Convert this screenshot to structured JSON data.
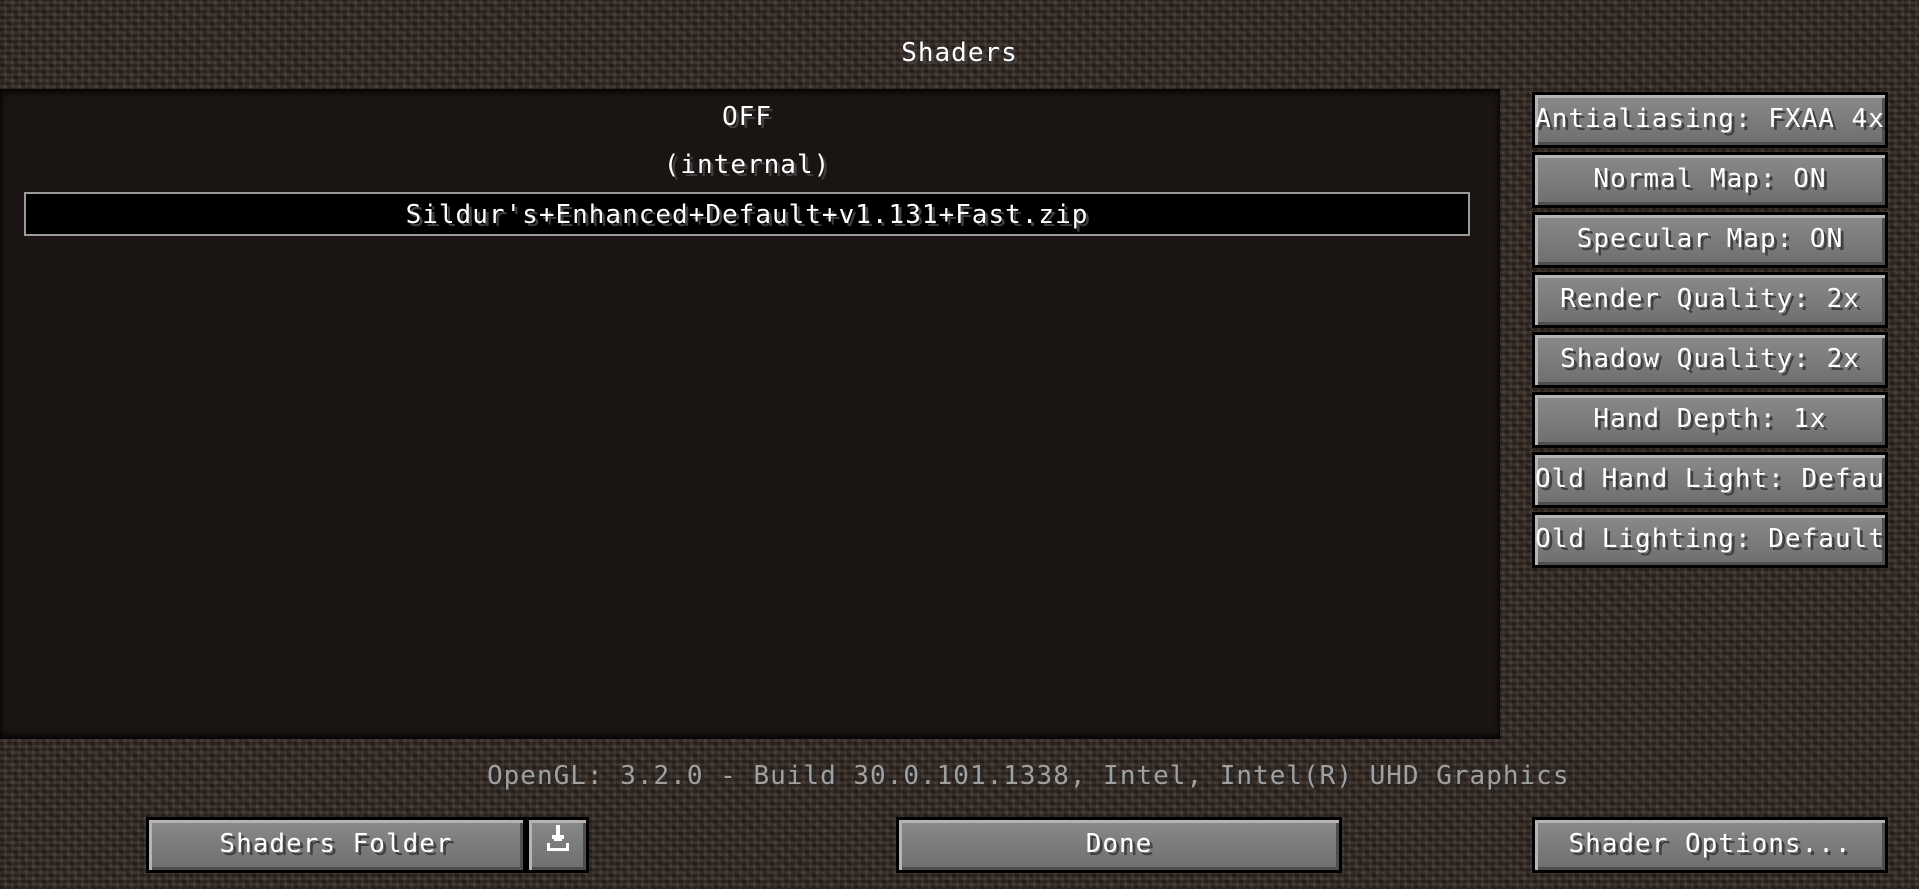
{
  "screen": {
    "title": "Shaders"
  },
  "shader_list": {
    "items": [
      {
        "label": "OFF",
        "selected": false
      },
      {
        "label": "(internal)",
        "selected": false
      },
      {
        "label": "Sildur's+Enhanced+Default+v1.131+Fast.zip",
        "selected": true
      }
    ]
  },
  "options": [
    {
      "label": "Antialiasing: FXAA 4x"
    },
    {
      "label": "Normal Map: ON"
    },
    {
      "label": "Specular Map: ON"
    },
    {
      "label": "Render Quality: 2x"
    },
    {
      "label": "Shadow Quality: 2x"
    },
    {
      "label": "Hand Depth: 1x"
    },
    {
      "label": "Old Hand Light: Default"
    },
    {
      "label": "Old Lighting: Default"
    }
  ],
  "gl_info": "OpenGL: 3.2.0 - Build 30.0.101.1338, Intel, Intel(R) UHD Graphics",
  "bottom": {
    "shaders_folder_label": "Shaders Folder",
    "download_icon": "download-icon",
    "done_label": "Done",
    "shader_options_label": "Shader Options..."
  },
  "colors": {
    "panel_bg": "#1a1512",
    "button_face": "#7a7a7a",
    "selected_border": "#9a9a9a",
    "info_text": "#a0a0a0"
  }
}
